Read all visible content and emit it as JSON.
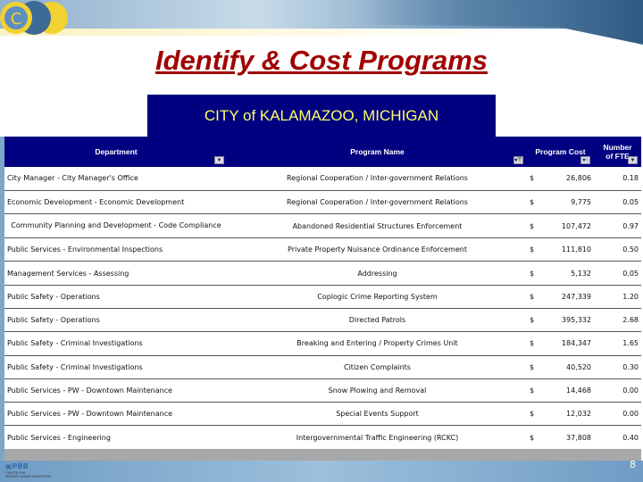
{
  "title": "Identify & Cost Programs",
  "city_header": "CITY of KALAMAZOO, MICHIGAN",
  "columns": {
    "department": "Department",
    "program": "Program Name",
    "cost": "Program Cost",
    "fte": "Number of FTE"
  },
  "rows": [
    {
      "department": "City Manager - City Manager's Office",
      "program": "Regional Cooperation / Inter-government Relations",
      "cur": "$",
      "cost": "26,806",
      "fte": "0.18"
    },
    {
      "department": "Economic Development - Economic Development",
      "program": "Regional Cooperation / Inter-government Relations",
      "cur": "$",
      "cost": "9,775",
      "fte": "0.05"
    },
    {
      "department": "Community Planning and Development - Code Compliance",
      "program": "Abandoned Residential Structures Enforcement",
      "cur": "$",
      "cost": "107,472",
      "fte": "0.97"
    },
    {
      "department": "Public Services - Environmental Inspections",
      "program": "Private Property Nuisance Ordinance Enforcement",
      "cur": "$",
      "cost": "111,810",
      "fte": "0.50"
    },
    {
      "department": "Management Services - Assessing",
      "program": "Addressing",
      "cur": "$",
      "cost": "5,132",
      "fte": "0.05"
    },
    {
      "department": "Public Safety - Operations",
      "program": "Coplogic Crime Reporting System",
      "cur": "$",
      "cost": "247,339",
      "fte": "1.20"
    },
    {
      "department": "Public Safety - Operations",
      "program": "Directed Patrols",
      "cur": "$",
      "cost": "395,332",
      "fte": "2.68"
    },
    {
      "department": "Public Safety - Criminal Investigations",
      "program": "Breaking and Entering / Property Crimes Unit",
      "cur": "$",
      "cost": "184,347",
      "fte": "1.65"
    },
    {
      "department": "Public Safety - Criminal Investigations",
      "program": "Citizen Complaints",
      "cur": "$",
      "cost": "40,520",
      "fte": "0.30"
    },
    {
      "department": "Public Services - PW - Downtown Maintenance",
      "program": "Snow Plowing and Removal",
      "cur": "$",
      "cost": "14,468",
      "fte": "0.00"
    },
    {
      "department": "Public Services - PW - Downtown Maintenance",
      "program": "Special Events Support",
      "cur": "$",
      "cost": "12,032",
      "fte": "0.00"
    },
    {
      "department": "Public Services - Engineering",
      "program": "Intergovernmental Traffic Engineering (RCKC)",
      "cur": "$",
      "cost": "37,808",
      "fte": "0.40"
    }
  ],
  "footer": {
    "logo": "PBB",
    "logo_sub": "CENTER FOR PRIORITY BASED BUDGETING",
    "page_number": "8"
  },
  "colors": {
    "title": "#a00000",
    "header_bg": "#000080",
    "city_text": "#ffff66"
  }
}
